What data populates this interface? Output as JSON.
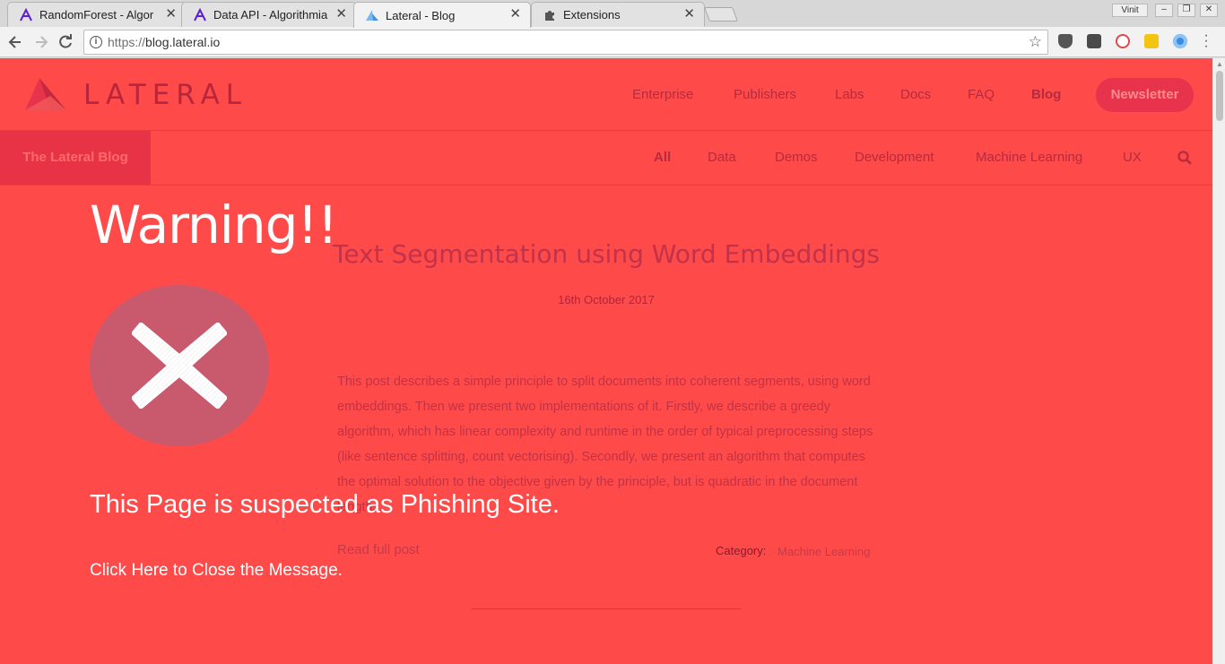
{
  "browser": {
    "tabs": [
      {
        "title": "RandomForest - Algorith",
        "favicon": "algorithmia-icon",
        "active": false
      },
      {
        "title": "Data API - Algorithmia",
        "favicon": "algorithmia-icon",
        "active": false
      },
      {
        "title": "Lateral - Blog",
        "favicon": "lateral-icon",
        "active": true
      },
      {
        "title": "Extensions",
        "favicon": "puzzle-icon",
        "active": false
      }
    ],
    "tab_close_glyph": "✕",
    "user_name": "Vinit",
    "url_scheme": "https://",
    "url_host": "blog.lateral.io"
  },
  "site": {
    "logo_text": "LATERAL",
    "nav": [
      {
        "label": "Enterprise"
      },
      {
        "label": "Publishers"
      },
      {
        "label": "Labs"
      },
      {
        "label": "Docs"
      },
      {
        "label": "FAQ"
      },
      {
        "label": "Blog",
        "current": true
      }
    ],
    "newsletter_label": "Newsletter",
    "blog_label": "The Lateral Blog",
    "categories": [
      {
        "label": "All",
        "current": true
      },
      {
        "label": "Data"
      },
      {
        "label": "Demos"
      },
      {
        "label": "Development"
      },
      {
        "label": "Machine Learning"
      },
      {
        "label": "UX"
      }
    ]
  },
  "post": {
    "title": "Text Segmentation using Word Embeddings",
    "date": "16th October 2017",
    "excerpt": "This post describes a simple principle to split documents into coherent segments, using word embeddings. Then we present two implementations of it. Firstly, we describe a greedy algorithm, which has linear complexity  and runtime in the order of typical preprocessing steps (like sentence splitting, count vectorising). Secondly, we present an algorithm that computes the optimal solution to the objective given by the principle, but is quadratic in the document lengths.",
    "read_more": "Read full post",
    "category_label": "Category:",
    "category_value": "Machine Learning"
  },
  "warning": {
    "title": "Warning!!",
    "message": "This Page is suspected as Phishing Site.",
    "close_text": "Click Here to Close the Message."
  },
  "colors": {
    "page_background": "#ff4a4a",
    "brand_text": "#b52b3f",
    "warning_circle": "#c95a6d"
  }
}
